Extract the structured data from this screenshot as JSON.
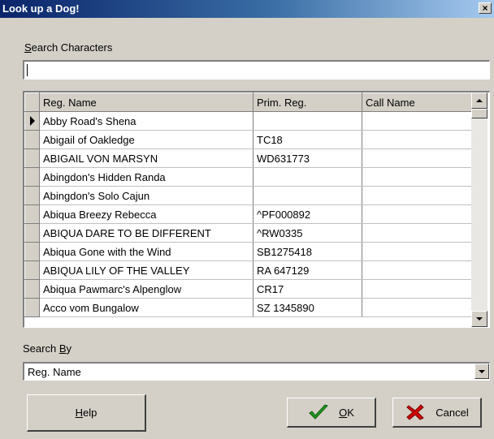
{
  "window": {
    "title": "Look up a Dog!",
    "close_label": "×"
  },
  "search": {
    "label_mnemonic": "S",
    "label_rest": "earch Characters",
    "value": ""
  },
  "grid": {
    "columns": [
      "Reg. Name",
      "Prim. Reg.",
      "Call Name"
    ],
    "selected_row": 0,
    "rows": [
      {
        "reg_name": "Abby Road's Shena",
        "prim_reg": "",
        "call_name": ""
      },
      {
        "reg_name": "Abigail of Oakledge",
        "prim_reg": "TC18",
        "call_name": ""
      },
      {
        "reg_name": "ABIGAIL VON MARSYN",
        "prim_reg": "WD631773",
        "call_name": ""
      },
      {
        "reg_name": "Abingdon's Hidden Randa",
        "prim_reg": "",
        "call_name": ""
      },
      {
        "reg_name": "Abingdon's Solo Cajun",
        "prim_reg": "",
        "call_name": ""
      },
      {
        "reg_name": "Abiqua Breezy Rebecca",
        "prim_reg": "^PF000892",
        "call_name": ""
      },
      {
        "reg_name": "ABIQUA DARE TO BE DIFFERENT",
        "prim_reg": "^RW0335",
        "call_name": ""
      },
      {
        "reg_name": "Abiqua Gone with the Wind",
        "prim_reg": "SB1275418",
        "call_name": ""
      },
      {
        "reg_name": "ABIQUA LILY OF THE VALLEY",
        "prim_reg": "RA 647129",
        "call_name": ""
      },
      {
        "reg_name": "Abiqua Pawmarc's Alpenglow",
        "prim_reg": "CR17",
        "call_name": ""
      },
      {
        "reg_name": "Acco vom Bungalow",
        "prim_reg": "SZ 1345890",
        "call_name": ""
      }
    ]
  },
  "search_by": {
    "label_before": "Search ",
    "label_mnemonic": "B",
    "label_after": "y",
    "selected": "Reg. Name"
  },
  "buttons": {
    "help_mnemonic": "H",
    "help_rest": "elp",
    "ok_mnemonic": "O",
    "ok_rest": "K",
    "cancel": "Cancel"
  },
  "colors": {
    "title_start": "#0a246a",
    "title_end": "#a6caf0",
    "ok_check": "#1f9a1f",
    "cancel_x": "#cc0000",
    "face": "#d4d0c8"
  }
}
